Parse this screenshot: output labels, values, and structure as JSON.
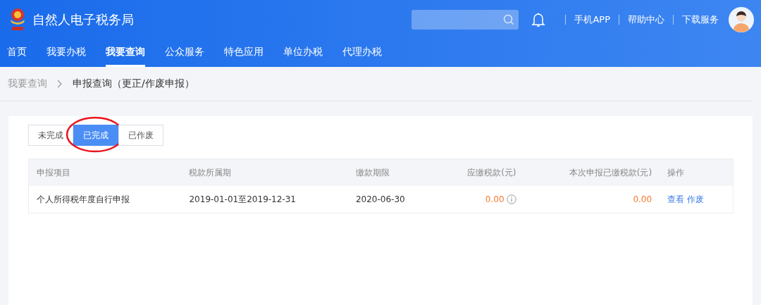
{
  "header": {
    "title": "自然人电子税务局",
    "links": [
      "手机APP",
      "帮助中心",
      "下载服务"
    ]
  },
  "nav": [
    {
      "label": "首页",
      "selected": false
    },
    {
      "label": "我要办税",
      "selected": false
    },
    {
      "label": "我要查询",
      "selected": true
    },
    {
      "label": "公众服务",
      "selected": false
    },
    {
      "label": "特色应用",
      "selected": false
    },
    {
      "label": "单位办税",
      "selected": false
    },
    {
      "label": "代理办税",
      "selected": false
    }
  ],
  "breadcrumb": [
    "我要查询",
    "申报查询（更正/作废申报）"
  ],
  "tabs": [
    {
      "label": "未完成",
      "selected": false,
      "highlighted": false
    },
    {
      "label": "已完成",
      "selected": true,
      "highlighted": true
    },
    {
      "label": "已作废",
      "selected": false,
      "highlighted": false
    }
  ],
  "table": {
    "columns": [
      "申报项目",
      "税款所属期",
      "缴款期限",
      "应缴税款(元)",
      "本次申报已缴税款(元)",
      "操作"
    ],
    "rows": [
      {
        "item": "个人所得税年度自行申报",
        "period": "2019-01-01至2019-12-31",
        "deadline": "2020-06-30",
        "tax_due": "0.00",
        "tax_due_info": true,
        "tax_paid": "0.00",
        "actions": [
          "查看",
          "作废"
        ]
      }
    ]
  }
}
